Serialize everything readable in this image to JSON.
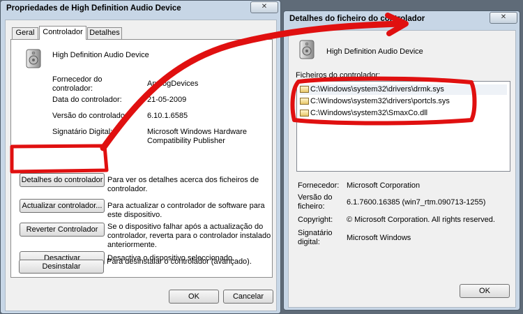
{
  "left_window": {
    "title": "Propriedades de High Definition Audio Device",
    "close_label": "✕",
    "tabs": [
      "Geral",
      "Controlador",
      "Detalhes"
    ],
    "device_name": "High Definition Audio Device",
    "fields": {
      "provider_label": "Fornecedor do\ncontrolador:",
      "provider_value": "AnalogDevices",
      "date_label": "Data do controlador:",
      "date_value": "21-05-2009",
      "version_label": "Versão do controlador:",
      "version_value": "6.10.1.6585",
      "signer_label": "Signatário Digital:",
      "signer_value": "Microsoft Windows Hardware\nCompatibility Publisher"
    },
    "actions": [
      {
        "button": "Detalhes do controlador",
        "desc": "Para ver os detalhes acerca dos ficheiros de\ncontrolador."
      },
      {
        "button": "Actualizar controlador...",
        "desc": "Para actualizar o controlador de software para\neste dispositivo."
      },
      {
        "button": "Reverter Controlador",
        "desc": "Se o dispositivo falhar após a actualização do\ncontrolador, reverta para o controlador instalado\nanteriormente."
      },
      {
        "button": "Desactivar",
        "desc": "Desactiva o dispositivo seleccionado."
      },
      {
        "button": "Desinstalar",
        "desc": "Para desinstalar o controlador (avançado)."
      }
    ],
    "ok_label": "OK",
    "cancel_label": "Cancelar"
  },
  "right_window": {
    "title": "Detalhes do ficheiro do controlador",
    "close_label": "✕",
    "device_name": "High Definition Audio Device",
    "files_label": "Ficheiros do controlador:",
    "files": [
      "C:\\Windows\\system32\\drivers\\drmk.sys",
      "C:\\Windows\\system32\\drivers\\portcls.sys",
      "C:\\Windows\\system32\\SmaxCo.dll"
    ],
    "details": {
      "provider_label": "Fornecedor:",
      "provider_value": "Microsoft Corporation",
      "version_label": "Versão do\nficheiro:",
      "version_value": "6.1.7600.16385 (win7_rtm.090713-1255)",
      "copyright_label": "Copyright:",
      "copyright_value": "© Microsoft Corporation. All rights reserved.",
      "signer_label": "Signatário\ndigital:",
      "signer_value": "Microsoft Windows"
    },
    "ok_label": "OK"
  },
  "annotation_color": "#e01010"
}
